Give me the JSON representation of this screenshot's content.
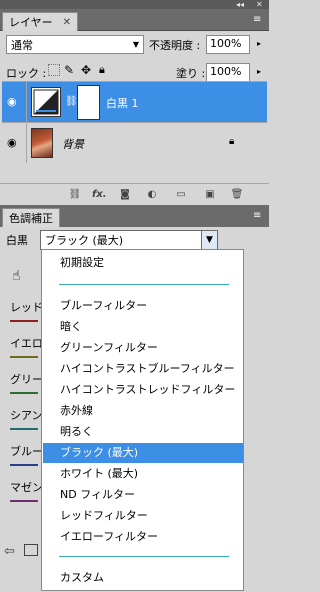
{
  "layers_panel": {
    "tab_label": "レイヤー",
    "blend_mode": "通常",
    "opacity_label": "不透明度 :",
    "opacity_value": "100%",
    "lock_label": "ロック :",
    "fill_label": "塗り :",
    "fill_value": "100%",
    "layers": [
      {
        "name": "白黒 1",
        "selected": true
      },
      {
        "name": "背景",
        "selected": false
      }
    ],
    "footer_icons": [
      "link-icon",
      "fx-icon",
      "mask-icon",
      "adjustment-icon",
      "group-icon",
      "new-layer-icon",
      "trash-icon"
    ],
    "footer_fx": "fx."
  },
  "adjustments_panel": {
    "tab_label": "色調補正",
    "type_label": "白黒",
    "preset_selected": "ブラック (最大)",
    "side_labels": [
      "レッド系",
      "イエロー",
      "グリーン",
      "シアン",
      "ブルー",
      "マゼン"
    ],
    "side_colors": [
      "#8c1f1f",
      "#6f6a1a",
      "#2d6d2d",
      "#266c6c",
      "#2b3c8a",
      "#6e2b6e"
    ]
  },
  "dropdown": {
    "items": [
      {
        "label": "初期設定"
      },
      {
        "label": "ブルーフィルター"
      },
      {
        "label": "暗く"
      },
      {
        "label": "グリーンフィルター"
      },
      {
        "label": "ハイコントラストブルーフィルター"
      },
      {
        "label": "ハイコントラストレッドフィルター"
      },
      {
        "label": "赤外線"
      },
      {
        "label": "明るく"
      },
      {
        "label": "ブラック (最大)",
        "selected": true
      },
      {
        "label": "ホワイト (最大)"
      },
      {
        "label": "ND フィルター"
      },
      {
        "label": "レッドフィルター"
      },
      {
        "label": "イエローフィルター"
      },
      {
        "label": "カスタム"
      }
    ]
  },
  "colors": {
    "selection": "#3d8ee5",
    "panel_bg": "#d6d6d6",
    "separator": "#3aa8b8"
  }
}
